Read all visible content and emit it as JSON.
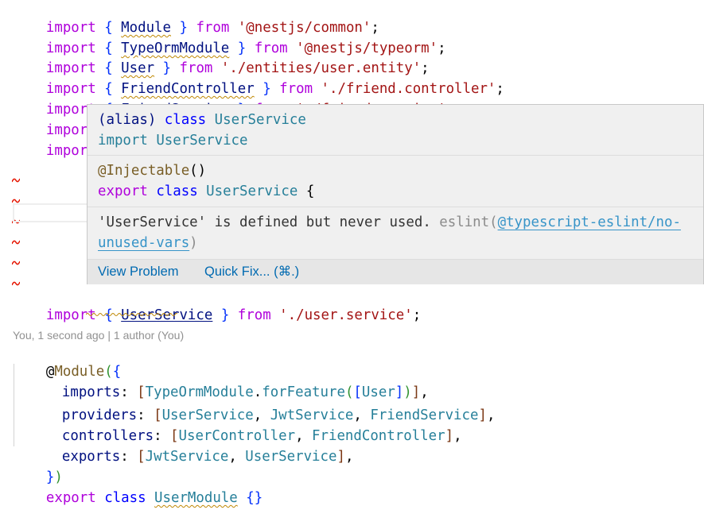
{
  "editor": {
    "lines": [
      {
        "kw": "import",
        "open": "{",
        "name": "Module",
        "close": "}",
        "from": "from",
        "path": "'@nestjs/common'",
        "semi": ";"
      },
      {
        "kw": "import",
        "open": "{",
        "name": "TypeOrmModule",
        "close": "}",
        "from": "from",
        "path": "'@nestjs/typeorm'",
        "semi": ";"
      },
      {
        "kw": "import",
        "open": "{",
        "name": "User",
        "close": "}",
        "from": "from",
        "path": "'./entities/user.entity'",
        "semi": ";"
      },
      {
        "kw": "import",
        "open": "{",
        "name": "FriendController",
        "close": "}",
        "from": "from",
        "path": "'./friend.controller'",
        "semi": ";"
      },
      {
        "kw": "import",
        "open": "{",
        "name": "FriendService",
        "close": "}",
        "from": "from",
        "path": "'./friend.service'",
        "semi": ";"
      },
      {
        "kw": "import",
        "open": "{"
      },
      {
        "kw": "import",
        "open": "{"
      }
    ],
    "user_service_import": {
      "kw": "import",
      "open": "{",
      "name": "UserService",
      "close": "}",
      "from": "from",
      "path": "'./user.service'",
      "semi": ";"
    },
    "codelens": "You, 1 second ago | 1 author (You)",
    "decorator": {
      "at": "@",
      "name": "Module",
      "open_paren": "(",
      "open_brace": "{"
    },
    "props": [
      {
        "key": "imports",
        "value_parts": [
          "TypeOrmModule",
          ".",
          "forFeature",
          "(",
          "[",
          "User",
          "]",
          ")"
        ]
      },
      {
        "key": "providers",
        "items": [
          "UserService",
          "JwtService",
          "FriendService"
        ]
      },
      {
        "key": "controllers",
        "items": [
          "UserController",
          "FriendController"
        ]
      },
      {
        "key": "exports",
        "items": [
          "JwtService",
          "UserService"
        ]
      }
    ],
    "close_decorator": {
      "brace": "}",
      "paren": ")"
    },
    "class_decl": {
      "export": "export",
      "class": "class",
      "name": "UserModule",
      "body": "{}"
    }
  },
  "hover": {
    "signature": {
      "line1": {
        "alias": "(alias)",
        "class_kw": "class",
        "name": "UserService"
      },
      "line2": {
        "import_kw": "import",
        "name": "UserService"
      }
    },
    "declaration": {
      "decorator": "@Injectable",
      "decorator_parens": "()",
      "export_kw": "export",
      "class_kw": "class",
      "name": "UserService",
      "brace": "{"
    },
    "message": {
      "text": "'UserService' is defined but never used.",
      "source": "eslint(",
      "rule_part1": "@typescript-eslint/no-",
      "rule_part2": "unused-vars",
      "source_close": ")"
    },
    "actions": {
      "view_problem": "View Problem",
      "quick_fix": "Quick Fix... (⌘.)"
    }
  }
}
